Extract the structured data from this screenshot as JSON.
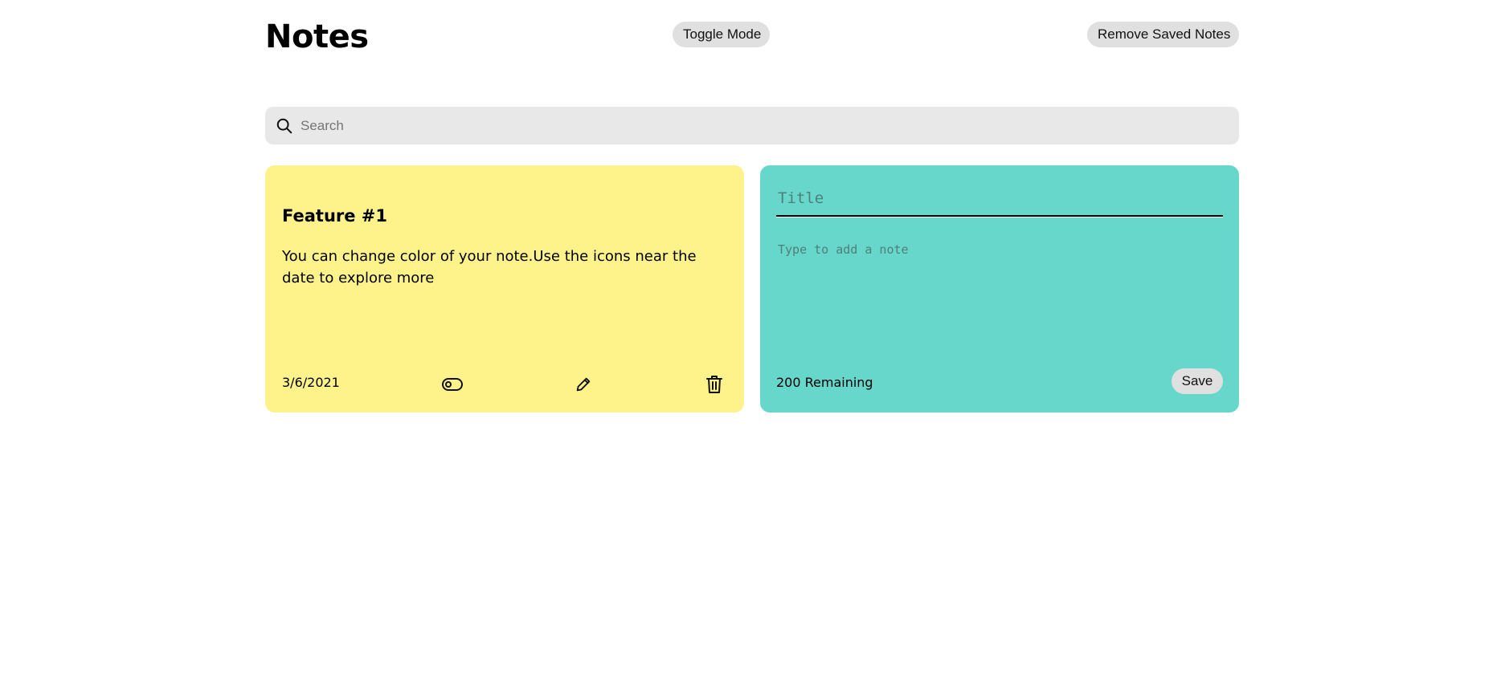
{
  "header": {
    "title": "Notes",
    "toggle_mode_label": "Toggle Mode",
    "remove_saved_label": "Remove Saved Notes"
  },
  "search": {
    "placeholder": "Search",
    "icon": "search-icon"
  },
  "notes": [
    {
      "title": "Feature #1",
      "text": "You can change color of your note.Use the icons near the date to explore more",
      "date": "3/6/2021",
      "color": "#fdf38a",
      "icons": [
        "color-toggle-icon",
        "edit-icon",
        "delete-icon"
      ]
    }
  ],
  "new_note": {
    "title_placeholder": "Title",
    "text_placeholder": "Type to add a note",
    "remaining_text": "200 Remaining",
    "save_label": "Save",
    "color": "#67d7cc"
  },
  "colors": {
    "background": "#ffffff",
    "button": "#e0e0e0",
    "search_background": "#e8e8e8"
  }
}
